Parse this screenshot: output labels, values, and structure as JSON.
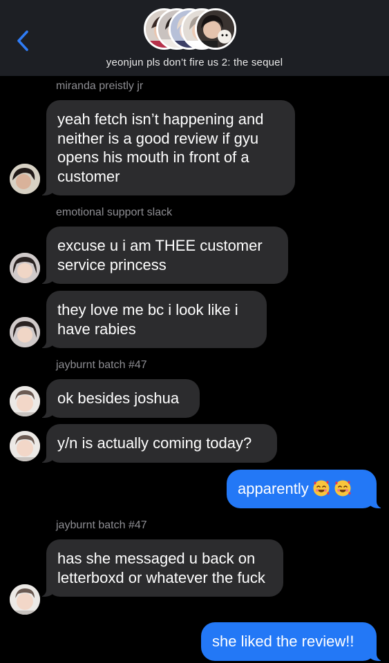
{
  "header": {
    "back_icon": "chevron-left-icon",
    "group_title": "yeonjun pls don’t fire us 2: the sequel",
    "accent": "#2f7cf6"
  },
  "messages": [
    {
      "sender": "miranda preistly jr"
    },
    {
      "text": "yeah fetch isn’t happening and neither is a good review if gyu opens his mouth in front of a customer"
    },
    {
      "sender": "emotional support slack"
    },
    {
      "text": "excuse u i am THEE customer service princess"
    },
    {
      "text": "they love me bc i look like i have rabies"
    },
    {
      "sender": "jayburnt batch #47"
    },
    {
      "text": "ok besides joshua"
    },
    {
      "text": "y/n is actually coming today?"
    },
    {
      "text": "apparently",
      "emoji": "smiling-face-with-hearts-icon"
    },
    {
      "sender": "jayburnt batch #47"
    },
    {
      "text": "has she messaged u back on letterboxd or whatever the fuck"
    },
    {
      "text": "she liked the review!!"
    }
  ],
  "colors": {
    "incoming_bubble": "#2c2c2e",
    "outgoing_bubble": "#2378f6",
    "sender_label": "#8e8e93",
    "header_bg": "#1d1f24"
  }
}
